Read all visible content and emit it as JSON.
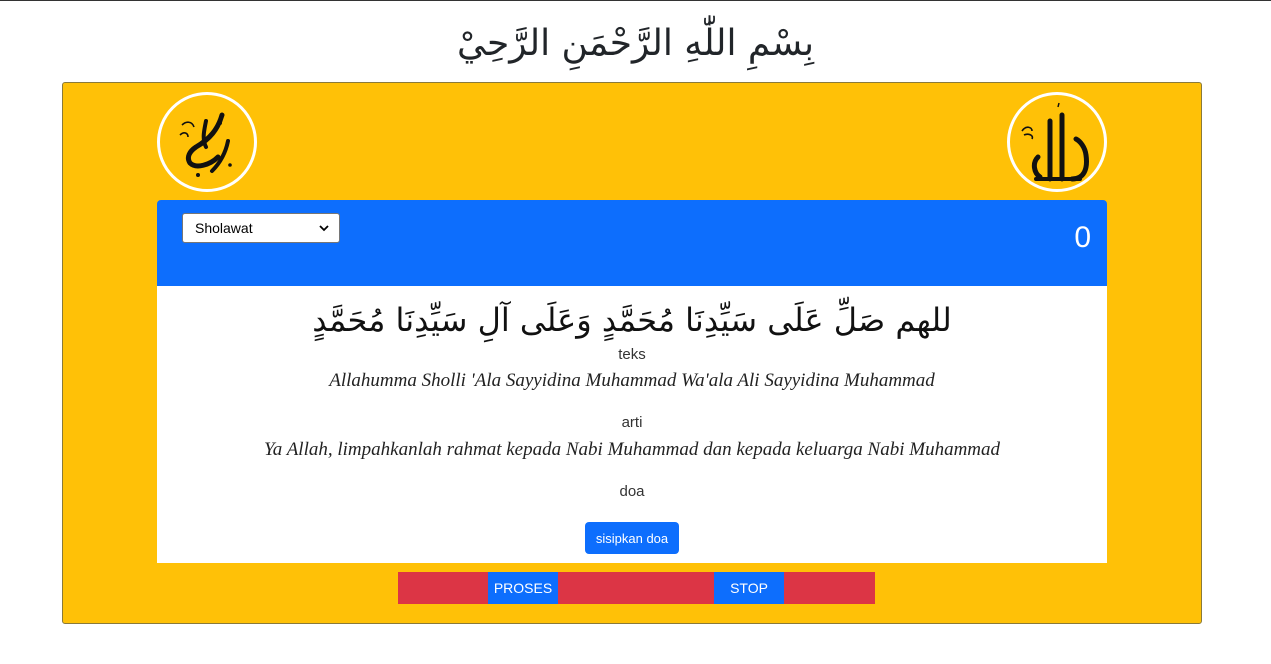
{
  "header": {
    "bismillah": "بِسْمِ اللّٰهِ الرَّحْمَنِ الرَّحِيْ"
  },
  "medallions": {
    "left_icon": "muhammad-calligraphy-icon",
    "right_icon": "allah-calligraphy-icon"
  },
  "panel": {
    "select_value": "Sholawat",
    "counter": "0"
  },
  "content": {
    "arabic": "للهم صَلِّ عَلَى سَيِّدِنَا مُحَمَّدٍ وَعَلَى آلِ سَيِّدِنَا مُحَمَّدٍ",
    "teks_label": "teks",
    "teks_value": "Allahumma Sholli 'Ala Sayyidina Muhammad Wa'ala Ali Sayyidina Muhammad",
    "arti_label": "arti",
    "arti_value": "Ya Allah, limpahkanlah rahmat kepada Nabi Muhammad dan kepada keluarga Nabi Muhammad",
    "doa_label": "doa",
    "doa_button": "sisipkan doa"
  },
  "controls": {
    "proses": "PROSES",
    "stop": "STOP"
  },
  "colors": {
    "card": "#ffc107",
    "primary": "#0d6efd",
    "danger": "#dc3545"
  }
}
